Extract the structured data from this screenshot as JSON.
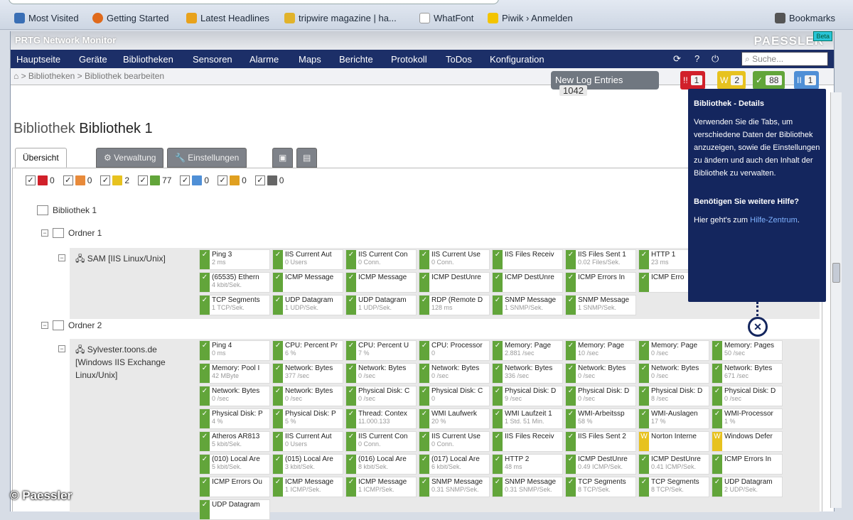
{
  "bookmarks": [
    {
      "label": "Most Visited",
      "color": "#3a6fb5"
    },
    {
      "label": "Getting Started",
      "color": "#e06a1b"
    },
    {
      "label": "Latest Headlines",
      "color": "#e8a21c"
    },
    {
      "label": "tripwire magazine | ha...",
      "color": "#e1b32b"
    },
    {
      "label": "WhatFont",
      "color": "#d9dde4"
    },
    {
      "label": "Piwik › Anmelden",
      "color": "#f3c400"
    },
    {
      "label": "Bookmarks",
      "color": "#555"
    }
  ],
  "app": {
    "title": "PRTG Network Monitor",
    "logo": "PAESSLER",
    "new_badge": "Beta"
  },
  "menu": [
    "Hauptseite",
    "Geräte",
    "Bibliotheken",
    "Sensoren",
    "Alarme",
    "Maps",
    "Berichte",
    "Protokoll",
    "ToDos",
    "Konfiguration"
  ],
  "search_placeholder": "Suche...",
  "breadcrumb": "⌂ > Bibliotheken > Bibliothek bearbeiten",
  "log": {
    "label": "New Log Entries",
    "count": "1042"
  },
  "status": [
    {
      "icon": "!!",
      "count": "1",
      "color": "#d1202a"
    },
    {
      "icon": "W",
      "count": "2",
      "color": "#e7c21f"
    },
    {
      "icon": "✓",
      "count": "88",
      "color": "#62a53a"
    },
    {
      "icon": "II",
      "count": "1",
      "color": "#4f8fd6"
    }
  ],
  "page": {
    "label": "Bibliothek",
    "name": "Bibliothek 1"
  },
  "tabs": {
    "overview": "Übersicht",
    "manage": "⚙ Verwaltung",
    "settings": "🔧 Einstellungen",
    "tool1": "▣",
    "tool2": "▤"
  },
  "filters": [
    {
      "icon": "!!",
      "count": "0",
      "color": "#d1202a"
    },
    {
      "icon": "!",
      "count": "0",
      "color": "#e88a3a"
    },
    {
      "icon": "W",
      "count": "2",
      "color": "#e7c21f"
    },
    {
      "icon": "✓",
      "count": "77",
      "color": "#62a53a"
    },
    {
      "icon": "II",
      "count": "0",
      "color": "#4f8fd6"
    },
    {
      "icon": "?",
      "count": "0",
      "color": "#e0a020"
    },
    {
      "icon": "?",
      "count": "0",
      "color": "#666"
    }
  ],
  "tree": {
    "library": "Bibliothek 1",
    "folder1": "Ordner 1",
    "folder2": "Ordner 2"
  },
  "device1": {
    "label": "SAM [IIS Linux/Unix]",
    "sensors": [
      {
        "n": "Ping 3",
        "v": "2 ms",
        "s": "ok"
      },
      {
        "n": "IIS Current Aut",
        "v": "0 Users",
        "s": "ok"
      },
      {
        "n": "IIS Current Con",
        "v": "0 Conn.",
        "s": "ok"
      },
      {
        "n": "IIS Current Use",
        "v": "0 Conn.",
        "s": "ok"
      },
      {
        "n": "IIS Files Receiv",
        "v": "",
        "s": "ok"
      },
      {
        "n": "IIS Files Sent 1",
        "v": "0.02 Files/Sek.",
        "s": "ok"
      },
      {
        "n": "HTTP 1",
        "v": "23 ms",
        "s": "ok"
      },
      {
        "n": "",
        "v": "",
        "s": "none"
      },
      {
        "n": "(65535) Ethern",
        "v": "4 kbit/Sek.",
        "s": "ok"
      },
      {
        "n": "ICMP Message",
        "v": "",
        "s": "ok"
      },
      {
        "n": "ICMP Message",
        "v": "",
        "s": "ok"
      },
      {
        "n": "ICMP DestUnre",
        "v": "",
        "s": "ok"
      },
      {
        "n": "ICMP DestUnre",
        "v": "",
        "s": "ok"
      },
      {
        "n": "ICMP Errors In",
        "v": "",
        "s": "ok"
      },
      {
        "n": "ICMP Erro",
        "v": "",
        "s": "ok"
      },
      {
        "n": "",
        "v": "",
        "s": "none"
      },
      {
        "n": "TCP Segments",
        "v": "1 TCP/Sek.",
        "s": "ok"
      },
      {
        "n": "UDP Datagram",
        "v": "1 UDP/Sek.",
        "s": "ok"
      },
      {
        "n": "UDP Datagram",
        "v": "1 UDP/Sek.",
        "s": "ok"
      },
      {
        "n": "RDP (Remote D",
        "v": "128 ms",
        "s": "ok"
      },
      {
        "n": "SNMP Message",
        "v": "1 SNMP/Sek.",
        "s": "ok"
      },
      {
        "n": "SNMP Message",
        "v": "1 SNMP/Sek.",
        "s": "ok"
      }
    ]
  },
  "device2": {
    "label": "Sylvester.toons.de [Windows IIS Exchange Linux/Unix]",
    "sensors": [
      {
        "n": "Ping 4",
        "v": "0 ms",
        "s": "ok"
      },
      {
        "n": "CPU: Percent Pr",
        "v": "6 %",
        "s": "ok"
      },
      {
        "n": "CPU: Percent U",
        "v": "7 %",
        "s": "ok"
      },
      {
        "n": "CPU: Processor",
        "v": "0",
        "s": "ok"
      },
      {
        "n": "Memory: Page",
        "v": "2.881 /sec",
        "s": "ok"
      },
      {
        "n": "Memory: Page",
        "v": "10 /sec",
        "s": "ok"
      },
      {
        "n": "Memory: Page",
        "v": "0 /sec",
        "s": "ok"
      },
      {
        "n": "Memory: Pages",
        "v": "50 /sec",
        "s": "ok"
      },
      {
        "n": "Memory: Pool I",
        "v": "42 MByte",
        "s": "ok"
      },
      {
        "n": "Network: Bytes",
        "v": "377 /sec",
        "s": "ok"
      },
      {
        "n": "Network: Bytes",
        "v": "0 /sec",
        "s": "ok"
      },
      {
        "n": "Network: Bytes",
        "v": "0 /sec",
        "s": "ok"
      },
      {
        "n": "Network: Bytes",
        "v": "336 /sec",
        "s": "ok"
      },
      {
        "n": "Network: Bytes",
        "v": "0 /sec",
        "s": "ok"
      },
      {
        "n": "Network: Bytes",
        "v": "0 /sec",
        "s": "ok"
      },
      {
        "n": "Network: Bytes",
        "v": "671 /sec",
        "s": "ok"
      },
      {
        "n": "Network: Bytes",
        "v": "0 /sec",
        "s": "ok"
      },
      {
        "n": "Network: Bytes",
        "v": "0 /sec",
        "s": "ok"
      },
      {
        "n": "Physical Disk: C",
        "v": "0 /sec",
        "s": "ok"
      },
      {
        "n": "Physical Disk: C",
        "v": "0",
        "s": "ok"
      },
      {
        "n": "Physical Disk: D",
        "v": "9 /sec",
        "s": "ok"
      },
      {
        "n": "Physical Disk: D",
        "v": "0 /sec",
        "s": "ok"
      },
      {
        "n": "Physical Disk: D",
        "v": "8 /sec",
        "s": "ok"
      },
      {
        "n": "Physical Disk: D",
        "v": "0 /sec",
        "s": "ok"
      },
      {
        "n": "Physical Disk: P",
        "v": "4 %",
        "s": "ok"
      },
      {
        "n": "Physical Disk: P",
        "v": "5 %",
        "s": "ok"
      },
      {
        "n": "Thread: Contex",
        "v": "11.000.133",
        "s": "ok"
      },
      {
        "n": "WMI Laufwerk",
        "v": "20 %",
        "s": "ok"
      },
      {
        "n": "WMI Laufzeit 1",
        "v": "1 Std. 51 Min.",
        "s": "ok"
      },
      {
        "n": "WMI-Arbeitssp",
        "v": "58 %",
        "s": "ok"
      },
      {
        "n": "WMI-Auslagen",
        "v": "17 %",
        "s": "ok"
      },
      {
        "n": "WMI-Processor",
        "v": "1 %",
        "s": "ok"
      },
      {
        "n": "Atheros AR813",
        "v": "5 kbit/Sek.",
        "s": "ok"
      },
      {
        "n": "IIS Current Aut",
        "v": "0 Users",
        "s": "ok"
      },
      {
        "n": "IIS Current Con",
        "v": "0 Conn.",
        "s": "ok"
      },
      {
        "n": "IIS Current Use",
        "v": "0 Conn.",
        "s": "ok"
      },
      {
        "n": "IIS Files Receiv",
        "v": "",
        "s": "ok"
      },
      {
        "n": "IIS Files Sent 2",
        "v": "",
        "s": "ok"
      },
      {
        "n": "Norton Interne",
        "v": "",
        "s": "w"
      },
      {
        "n": "Windows Defer",
        "v": "",
        "s": "w"
      },
      {
        "n": "(010) Local Are",
        "v": "5 kbit/Sek.",
        "s": "ok"
      },
      {
        "n": "(015) Local Are",
        "v": "3 kbit/Sek.",
        "s": "ok"
      },
      {
        "n": "(016) Local Are",
        "v": "8 kbit/Sek.",
        "s": "ok"
      },
      {
        "n": "(017) Local Are",
        "v": "6 kbit/Sek.",
        "s": "ok"
      },
      {
        "n": "HTTP 2",
        "v": "48 ms",
        "s": "ok"
      },
      {
        "n": "ICMP DestUnre",
        "v": "0.49 ICMP/Sek.",
        "s": "ok"
      },
      {
        "n": "ICMP DestUnre",
        "v": "0.41 ICMP/Sek.",
        "s": "ok"
      },
      {
        "n": "ICMP Errors In",
        "v": "",
        "s": "ok"
      },
      {
        "n": "ICMP Errors Ou",
        "v": "",
        "s": "ok"
      },
      {
        "n": "ICMP Message",
        "v": "1 ICMP/Sek.",
        "s": "ok"
      },
      {
        "n": "ICMP Message",
        "v": "1 ICMP/Sek.",
        "s": "ok"
      },
      {
        "n": "SNMP Message",
        "v": "0.31 SNMP/Sek.",
        "s": "ok"
      },
      {
        "n": "SNMP Message",
        "v": "0.31 SNMP/Sek.",
        "s": "ok"
      },
      {
        "n": "TCP Segments",
        "v": "8 TCP/Sek.",
        "s": "ok"
      },
      {
        "n": "TCP Segments",
        "v": "8 TCP/Sek.",
        "s": "ok"
      },
      {
        "n": "UDP Datagram",
        "v": "2 UDP/Sek.",
        "s": "ok"
      },
      {
        "n": "UDP Datagram",
        "v": "",
        "s": "ok"
      }
    ]
  },
  "help": {
    "title": "Bibliothek - Details",
    "body": "Verwenden Sie die Tabs, um verschiedene Daten der Bibliothek anzuzeigen, sowie die Einstellungen zu ändern und auch den Inhalt der Bibliothek zu verwalten.",
    "more_title": "Benötigen Sie weitere Hilfe?",
    "more_text": "Hier geht's zum ",
    "link": "Hilfe-Zentrum",
    "close": "✕"
  },
  "copyright": "© Paessler"
}
